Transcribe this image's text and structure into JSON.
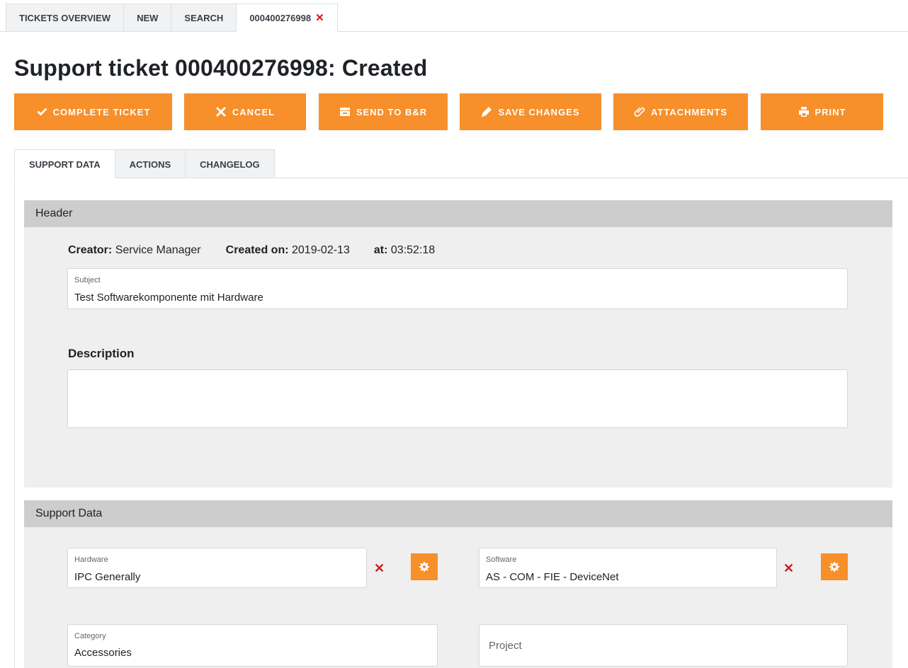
{
  "top_tabs": {
    "overview": "TICKETS OVERVIEW",
    "new": "NEW",
    "search": "SEARCH",
    "ticket": "000400276998",
    "close_glyph": "✕"
  },
  "page": {
    "title": "Support ticket 000400276998: Created"
  },
  "actions": {
    "complete": "COMPLETE TICKET",
    "cancel": "CANCEL",
    "send": "SEND TO B&R",
    "save": "SAVE CHANGES",
    "attachments": "ATTACHMENTS",
    "print": "PRINT"
  },
  "content_tabs": {
    "support_data": "SUPPORT DATA",
    "actions": "ACTIONS",
    "changelog": "CHANGELOG"
  },
  "header_panel": {
    "title": "Header",
    "creator_label": "Creator:",
    "creator_value": "Service Manager",
    "created_on_label": "Created on:",
    "created_on_value": "2019-02-13",
    "at_label": "at:",
    "at_value": "03:52:18",
    "subject_label": "Subject",
    "subject_value": "Test Softwarekomponente mit Hardware",
    "description_label": "Description",
    "description_value": ""
  },
  "support_panel": {
    "title": "Support Data",
    "hardware_label": "Hardware",
    "hardware_value": "IPC Generally",
    "software_label": "Software",
    "software_value": "AS - COM - FIE - DeviceNet",
    "category_label": "Category",
    "category_value": "Accessories",
    "project_placeholder": "Project",
    "clear_glyph": "✕"
  },
  "colors": {
    "accent": "#f78f2a",
    "danger": "#c8201c",
    "panel_header": "#cdcdcd",
    "panel_body": "#efefef"
  }
}
